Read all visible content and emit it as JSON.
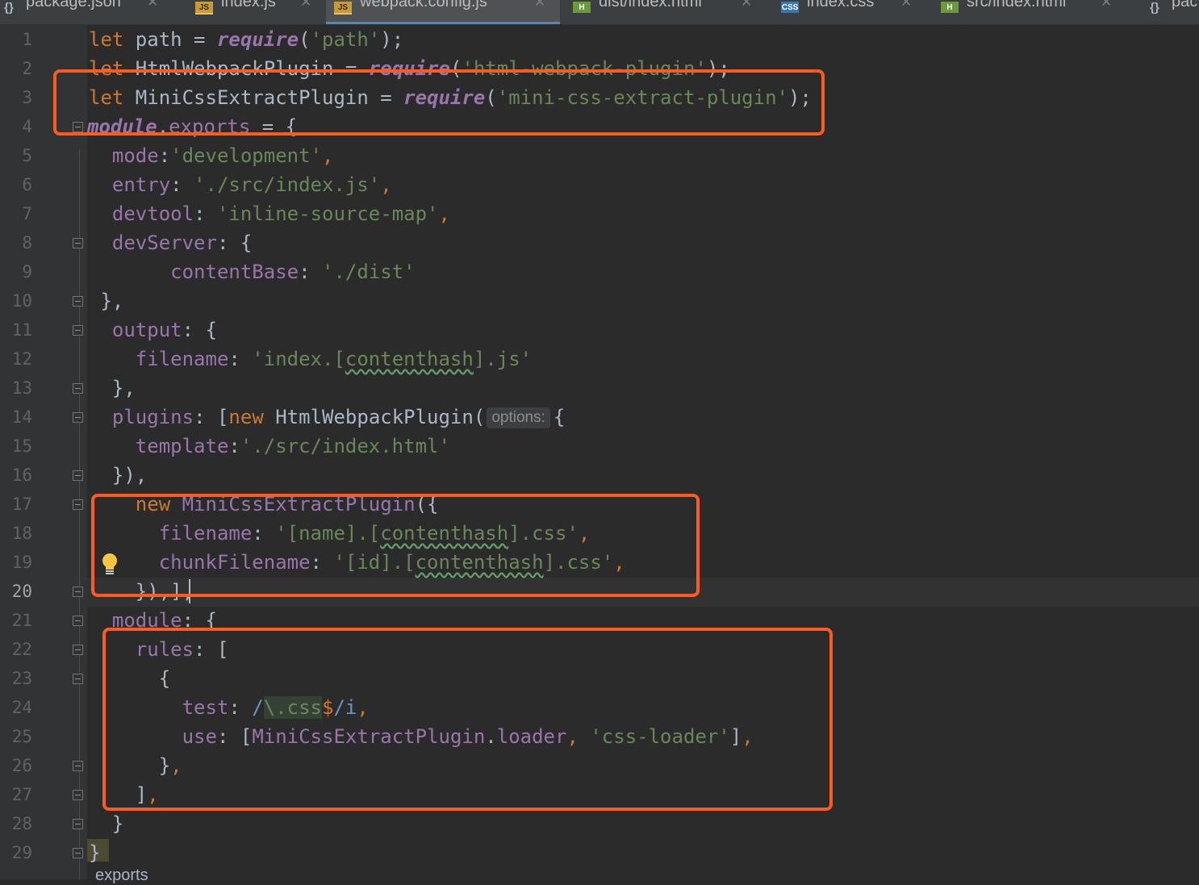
{
  "tabs": [
    {
      "label": "package.json",
      "icon": "json-file-icon",
      "badge": "{}"
    },
    {
      "label": "index.js",
      "icon": "js-file-icon",
      "badge": "JS"
    },
    {
      "label": "webpack.config.js",
      "icon": "js-file-icon",
      "badge": "JS",
      "active": true
    },
    {
      "label": "dist/index.html",
      "icon": "html-file-icon",
      "badge": "H"
    },
    {
      "label": "index.css",
      "icon": "css-file-icon",
      "badge": "CSS"
    },
    {
      "label": "src/index.html",
      "icon": "html-file-icon",
      "badge": "H"
    },
    {
      "label": "pac",
      "icon": "json-file-icon",
      "badge": "{}"
    }
  ],
  "editor": {
    "current_line": 20,
    "line_numbers": [
      "1",
      "2",
      "3",
      "4",
      "5",
      "6",
      "7",
      "8",
      "9",
      "10",
      "11",
      "12",
      "13",
      "14",
      "15",
      "16",
      "17",
      "18",
      "19",
      "20",
      "21",
      "22",
      "23",
      "24",
      "25",
      "26",
      "27",
      "28",
      "29"
    ],
    "param_hint": "options:",
    "breadcrumb": "exports",
    "colors": {
      "background": "#2b2b2b",
      "gutter": "#313335",
      "keyword": "#cc7832",
      "string": "#6a8759",
      "property": "#9876aa",
      "annotation_box": "#ff5a1f",
      "active_tab_underline": "#4a88c7"
    },
    "lines": [
      [
        [
          "kw",
          "let"
        ],
        [
          "txt",
          " path = "
        ],
        [
          "fn",
          "require"
        ],
        [
          "txt",
          "("
        ],
        [
          "str",
          "'path'"
        ],
        [
          "txt",
          ");"
        ]
      ],
      [
        [
          "kw",
          "let"
        ],
        [
          "txt",
          " HtmlWebpackPlugin = "
        ],
        [
          "fn",
          "require"
        ],
        [
          "txt",
          "("
        ],
        [
          "str",
          "'html-webpack-plugin'"
        ],
        [
          "txt",
          ");"
        ]
      ],
      [
        [
          "kw",
          "let"
        ],
        [
          "txt",
          " MiniCssExtractPlugin = "
        ],
        [
          "fn",
          "require"
        ],
        [
          "txt",
          "("
        ],
        [
          "str",
          "'mini-css-extract-plugin'"
        ],
        [
          "txt",
          ");"
        ]
      ],
      [
        [
          "fn",
          "module"
        ],
        [
          "txt",
          "."
        ],
        [
          "prop",
          "exports"
        ],
        [
          "txt",
          " = {"
        ]
      ],
      [
        [
          "txt",
          "  "
        ],
        [
          "prop",
          "mode"
        ],
        [
          "txt",
          ":"
        ],
        [
          "str",
          "'development'"
        ],
        [
          "kw",
          ","
        ]
      ],
      [
        [
          "txt",
          "  "
        ],
        [
          "prop",
          "entry"
        ],
        [
          "txt",
          ": "
        ],
        [
          "str",
          "'./src/index.js'"
        ],
        [
          "kw",
          ","
        ]
      ],
      [
        [
          "txt",
          "  "
        ],
        [
          "prop",
          "devtool"
        ],
        [
          "txt",
          ": "
        ],
        [
          "str",
          "'inline-source-map'"
        ],
        [
          "kw",
          ","
        ]
      ],
      [
        [
          "txt",
          "  "
        ],
        [
          "prop",
          "devServer"
        ],
        [
          "txt",
          ": {"
        ]
      ],
      [
        [
          "txt",
          "       "
        ],
        [
          "prop",
          "contentBase"
        ],
        [
          "txt",
          ": "
        ],
        [
          "str",
          "'./dist'"
        ]
      ],
      [
        [
          "txt",
          " },"
        ]
      ],
      [
        [
          "txt",
          "  "
        ],
        [
          "prop",
          "output"
        ],
        [
          "txt",
          ": {"
        ]
      ],
      [
        [
          "txt",
          "    "
        ],
        [
          "prop",
          "filename"
        ],
        [
          "txt",
          ": "
        ],
        [
          "str",
          "'index.["
        ],
        [
          "strtypo",
          "contenthash"
        ],
        [
          "str",
          "].js'"
        ]
      ],
      [
        [
          "txt",
          "  },"
        ]
      ],
      [
        [
          "txt",
          "  "
        ],
        [
          "prop",
          "plugins"
        ],
        [
          "txt",
          ": ["
        ],
        [
          "kw",
          "new "
        ],
        [
          "cls",
          "HtmlWebpackPlugin("
        ],
        [
          "hint",
          "options:"
        ],
        [
          "txt",
          "{"
        ]
      ],
      [
        [
          "txt",
          "    "
        ],
        [
          "prop",
          "template"
        ],
        [
          "txt",
          ":"
        ],
        [
          "str",
          "'./src/index.html'"
        ]
      ],
      [
        [
          "txt",
          "  }),"
        ]
      ],
      [
        [
          "txt",
          "    "
        ],
        [
          "kw",
          "new "
        ],
        [
          "prop",
          "MiniCssExtractPlugin"
        ],
        [
          "txt",
          "({"
        ]
      ],
      [
        [
          "txt",
          "      "
        ],
        [
          "prop",
          "filename"
        ],
        [
          "txt",
          ": "
        ],
        [
          "str",
          "'[name].["
        ],
        [
          "strtypo",
          "contenthash"
        ],
        [
          "str",
          "].css'"
        ],
        [
          "kw",
          ","
        ]
      ],
      [
        [
          "txt",
          "      "
        ],
        [
          "prop",
          "chunkFilename"
        ],
        [
          "txt",
          ": "
        ],
        [
          "str",
          "'[id].["
        ],
        [
          "strtypo",
          "contenthash"
        ],
        [
          "str",
          "].css'"
        ],
        [
          "kw",
          ","
        ]
      ],
      [
        [
          "txt",
          "    }),],"
        ]
      ],
      [
        [
          "txt",
          "  "
        ],
        [
          "prop",
          "module"
        ],
        [
          "txt",
          ": {"
        ]
      ],
      [
        [
          "txt",
          "    "
        ],
        [
          "prop",
          "rules"
        ],
        [
          "txt",
          ": ["
        ]
      ],
      [
        [
          "txt",
          "      {"
        ]
      ],
      [
        [
          "txt",
          "        "
        ],
        [
          "prop",
          "test"
        ],
        [
          "txt",
          ": "
        ],
        [
          "reg",
          "/"
        ],
        [
          "regx",
          "\\.css"
        ],
        [
          "kw",
          "$"
        ],
        [
          "reg",
          "/i"
        ],
        [
          "kw",
          ","
        ]
      ],
      [
        [
          "txt",
          "        "
        ],
        [
          "prop",
          "use"
        ],
        [
          "txt",
          ": ["
        ],
        [
          "prop",
          "MiniCssExtractPlugin"
        ],
        [
          "txt",
          "."
        ],
        [
          "prop",
          "loader"
        ],
        [
          "kw",
          ", "
        ],
        [
          "str",
          "'css-loader'"
        ],
        [
          "txt",
          "]"
        ],
        [
          "kw",
          ","
        ]
      ],
      [
        [
          "txt",
          "      }"
        ],
        [
          "kw",
          ","
        ]
      ],
      [
        [
          "txt",
          "    ]"
        ],
        [
          "kw",
          ","
        ]
      ],
      [
        [
          "txt",
          "  }"
        ]
      ],
      [
        [
          "txt",
          "}"
        ]
      ]
    ]
  }
}
